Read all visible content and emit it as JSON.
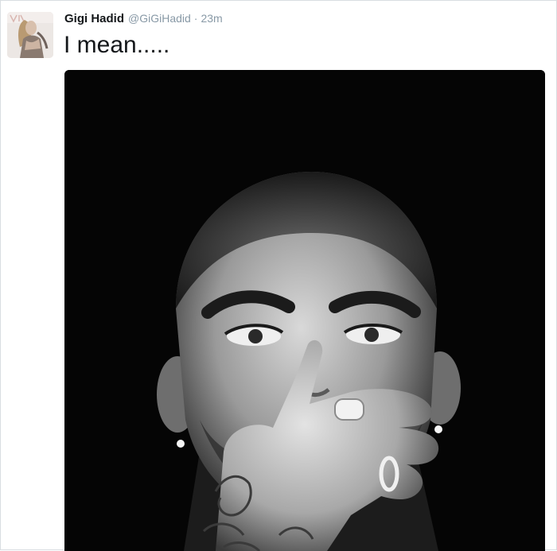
{
  "tweet": {
    "author_name": "Gigi Hadid",
    "author_handle": "@GiGiHadid",
    "separator": "·",
    "timestamp": "23m",
    "text": "I mean....."
  },
  "icons": {
    "avatar": "profile-photo",
    "media": "black-and-white-portrait-photo"
  },
  "colors": {
    "name": "#14171a",
    "meta": "#8899a6",
    "border": "#d8dde1",
    "photo_background": "#050505"
  }
}
